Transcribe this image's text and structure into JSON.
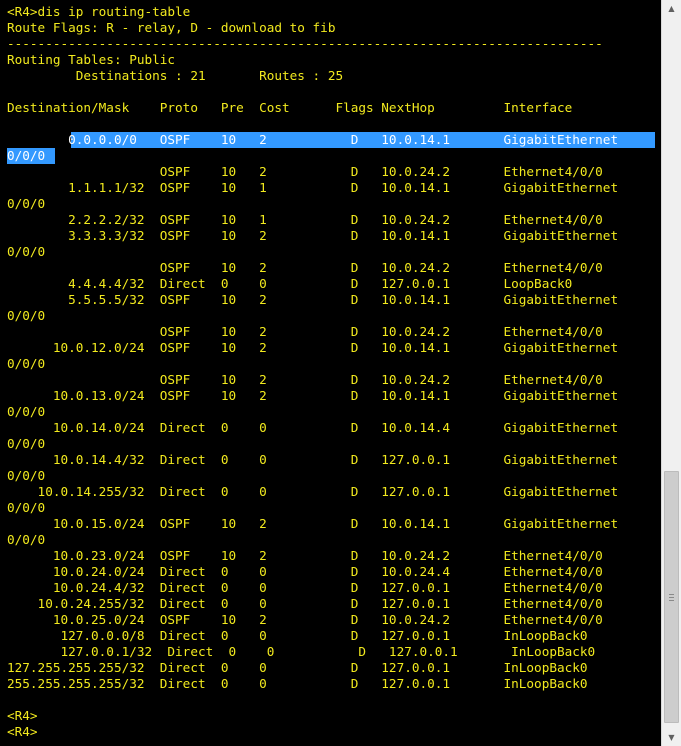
{
  "terminal": {
    "lines": [
      "<R4>dis ip routing-table",
      "Route Flags: R - relay, D - download to fib",
      "------------------------------------------------------------------------------",
      "Routing Tables: Public",
      "         Destinations : 21       Routes : 25",
      "",
      "Destination/Mask    Proto   Pre  Cost      Flags NextHop         Interface",
      "",
      "        0.0.0.0/0   OSPF    10   2           D   10.0.14.1       GigabitEthernet",
      "0/0/0",
      "                    OSPF    10   2           D   10.0.24.2       Ethernet4/0/0",
      "        1.1.1.1/32  OSPF    10   1           D   10.0.14.1       GigabitEthernet",
      "0/0/0",
      "        2.2.2.2/32  OSPF    10   1           D   10.0.24.2       Ethernet4/0/0",
      "        3.3.3.3/32  OSPF    10   2           D   10.0.14.1       GigabitEthernet",
      "0/0/0",
      "                    OSPF    10   2           D   10.0.24.2       Ethernet4/0/0",
      "        4.4.4.4/32  Direct  0    0           D   127.0.0.1       LoopBack0",
      "        5.5.5.5/32  OSPF    10   2           D   10.0.14.1       GigabitEthernet",
      "0/0/0",
      "                    OSPF    10   2           D   10.0.24.2       Ethernet4/0/0",
      "      10.0.12.0/24  OSPF    10   2           D   10.0.14.1       GigabitEthernet",
      "0/0/0",
      "                    OSPF    10   2           D   10.0.24.2       Ethernet4/0/0",
      "      10.0.13.0/24  OSPF    10   2           D   10.0.14.1       GigabitEthernet",
      "0/0/0",
      "      10.0.14.0/24  Direct  0    0           D   10.0.14.4       GigabitEthernet",
      "0/0/0",
      "      10.0.14.4/32  Direct  0    0           D   127.0.0.1       GigabitEthernet",
      "0/0/0",
      "    10.0.14.255/32  Direct  0    0           D   127.0.0.1       GigabitEthernet",
      "0/0/0",
      "      10.0.15.0/24  OSPF    10   2           D   10.0.14.1       GigabitEthernet",
      "0/0/0",
      "      10.0.23.0/24  OSPF    10   2           D   10.0.24.2       Ethernet4/0/0",
      "      10.0.24.0/24  Direct  0    0           D   10.0.24.4       Ethernet4/0/0",
      "      10.0.24.4/32  Direct  0    0           D   127.0.0.1       Ethernet4/0/0",
      "    10.0.24.255/32  Direct  0    0           D   127.0.0.1       Ethernet4/0/0",
      "      10.0.25.0/24  OSPF    10   2           D   10.0.24.2       Ethernet4/0/0",
      "       127.0.0.0/8  Direct  0    0           D   127.0.0.1       InLoopBack0",
      "       127.0.0.1/32  Direct  0    0           D   127.0.0.1       InLoopBack0",
      "127.255.255.255/32  Direct  0    0           D   127.0.0.1       InLoopBack0",
      "255.255.255.255/32  Direct  0    0           D   127.0.0.1       InLoopBack0",
      "",
      "<R4>",
      "<R4>"
    ]
  },
  "colors": {
    "background": "#000000",
    "text": "#f2ea1e",
    "selection": "#3399ff",
    "selection_text": "#ffffff"
  },
  "icons": {
    "scroll_up": "triangle-up-icon",
    "scroll_down": "triangle-down-icon"
  }
}
